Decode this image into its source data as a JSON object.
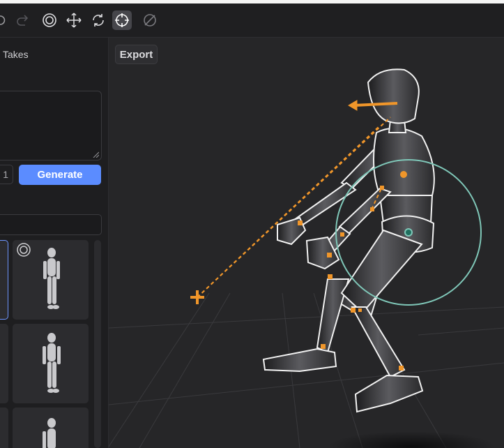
{
  "toolbar": {
    "icons": [
      "redo-icon-partial",
      "redo-icon",
      "target-icon",
      "move-icon",
      "rotate-icon",
      "crosshair-icon",
      "disable-icon"
    ],
    "active_tool": "crosshair-icon"
  },
  "left_panel": {
    "tab_label": "Takes",
    "count_value": "1",
    "generate_label": "Generate"
  },
  "viewport": {
    "export_label": "Export"
  },
  "colors": {
    "accent": "#5b8cff",
    "handle_orange": "#f0962a",
    "ring_teal": "#7fc7b8",
    "background": "#1b1b1d"
  }
}
